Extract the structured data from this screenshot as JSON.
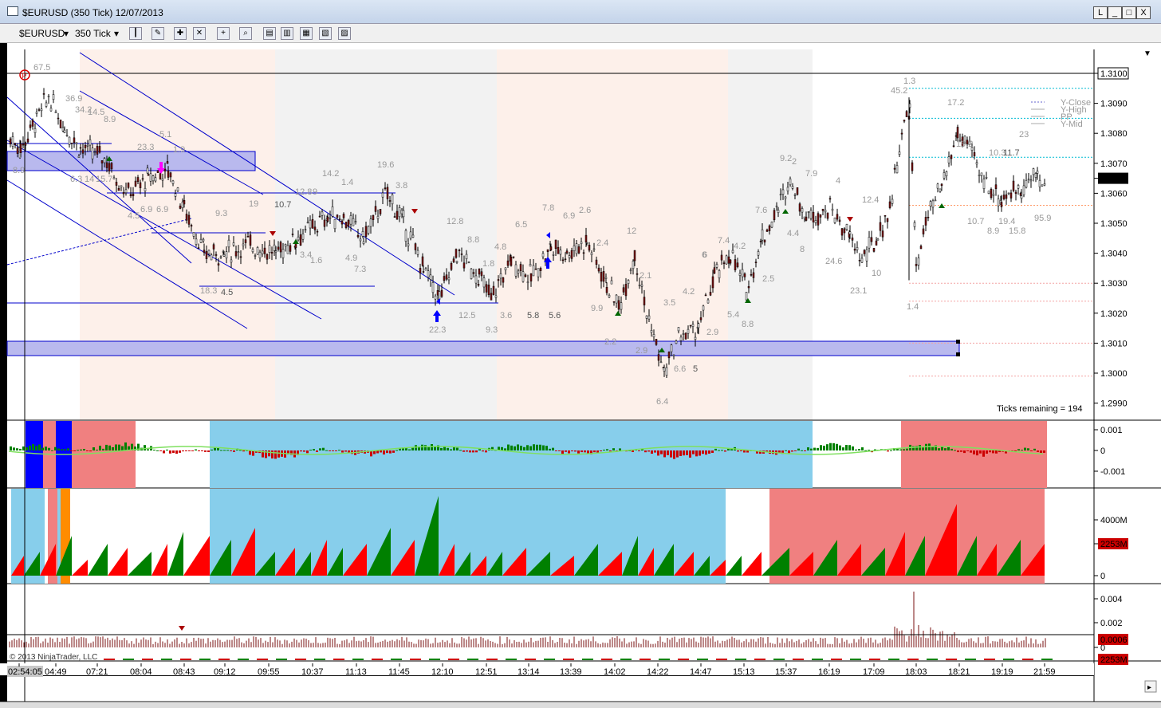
{
  "window": {
    "title": "$EURUSD (350 Tick)  12/07/2013",
    "controls": [
      "L",
      "_",
      "□",
      "X"
    ]
  },
  "toolbar": {
    "instrument": "$EURUSD",
    "interval": "350 Tick",
    "icons": [
      "bar-type-icon",
      "pencil-icon",
      "crosshair-add-icon",
      "crosshair-remove-icon",
      "crosshair-icon",
      "zoom-icon",
      "strategy-icon",
      "indicator-icon",
      "chart-trader-icon",
      "data-box-icon",
      "properties-icon"
    ]
  },
  "price_axis": {
    "ticks": [
      "1.3100",
      "1.3090",
      "1.3080",
      "1.3070",
      "1.3065",
      "1.3060",
      "1.3050",
      "1.3040",
      "1.3030",
      "1.3020",
      "1.3010",
      "1.3000",
      "1.2990"
    ],
    "current_price": "1.3065",
    "marked_level": "1.3100"
  },
  "legend": {
    "items": [
      "Y-Close",
      "Y-High",
      "PP",
      "Y-Mid"
    ]
  },
  "ticks_remaining": "Ticks remaining = 194",
  "panel2_axis": [
    "0.001",
    "0",
    "-0.001"
  ],
  "panel3_axis": [
    "4000M",
    "2253M",
    "0"
  ],
  "panel3_current": "2253M",
  "panel4_axis": [
    "0.004",
    "0.002",
    "0"
  ],
  "panel4_current": "0.0006",
  "panel5_current": "2253M",
  "time_axis": [
    "02:54:05",
    "04:49",
    "07:21",
    "08:04",
    "08:43",
    "09:12",
    "09:55",
    "10:37",
    "11:13",
    "11:45",
    "12:10",
    "12:51",
    "13:14",
    "13:39",
    "14:02",
    "14:22",
    "14:47",
    "15:13",
    "15:37",
    "16:19",
    "17:09",
    "18:03",
    "18:21",
    "19:19",
    "21:59"
  ],
  "copyright": "© 2013 NinjaTrader, LLC",
  "volume_labels": [
    {
      "t": "67.5",
      "c": "l"
    },
    {
      "t": "36.9",
      "c": "l"
    },
    {
      "t": "34.2",
      "c": "l"
    },
    {
      "t": "14.5",
      "c": "l"
    },
    {
      "t": "8.9",
      "c": "l"
    },
    {
      "t": "23.3",
      "c": "l"
    },
    {
      "t": "5.1",
      "c": "l"
    },
    {
      "t": "1.9",
      "c": "l"
    },
    {
      "t": "8.9",
      "c": "l"
    },
    {
      "t": "6.3",
      "c": "l"
    },
    {
      "t": "14",
      "c": "l"
    },
    {
      "t": "15.7",
      "c": "l"
    },
    {
      "t": "4.5",
      "c": "l"
    },
    {
      "t": "6.9",
      "c": "l"
    },
    {
      "t": "6.9",
      "c": "l"
    },
    {
      "t": "9.3",
      "c": "l"
    },
    {
      "t": "19",
      "c": "l"
    },
    {
      "t": "10.7",
      "c": "d"
    },
    {
      "t": "12.8",
      "c": "l"
    },
    {
      "t": "9",
      "c": "l"
    },
    {
      "t": "14.2",
      "c": "l"
    },
    {
      "t": "1.4",
      "c": "l"
    },
    {
      "t": "19.6",
      "c": "l"
    },
    {
      "t": "3.8",
      "c": "l"
    },
    {
      "t": "3.4",
      "c": "l"
    },
    {
      "t": "1.6",
      "c": "l"
    },
    {
      "t": "4.9",
      "c": "l"
    },
    {
      "t": "7.3",
      "c": "l"
    },
    {
      "t": "18.3",
      "c": "l"
    },
    {
      "t": "4.5",
      "c": "d"
    },
    {
      "t": "12.8",
      "c": "l"
    },
    {
      "t": "8.8",
      "c": "l"
    },
    {
      "t": "4.8",
      "c": "l"
    },
    {
      "t": "1.8",
      "c": "l"
    },
    {
      "t": "12.5",
      "c": "l"
    },
    {
      "t": "22.3",
      "c": "l"
    },
    {
      "t": "9.3",
      "c": "l"
    },
    {
      "t": "3.6",
      "c": "l"
    },
    {
      "t": "5.8",
      "c": "d"
    },
    {
      "t": "5.6",
      "c": "d"
    },
    {
      "t": "6.5",
      "c": "l"
    },
    {
      "t": "7.8",
      "c": "l"
    },
    {
      "t": "6.9",
      "c": "l"
    },
    {
      "t": "2.6",
      "c": "l"
    },
    {
      "t": "2.4",
      "c": "l"
    },
    {
      "t": "12",
      "c": "l"
    },
    {
      "t": "6",
      "c": "l"
    },
    {
      "t": "9.9",
      "c": "l"
    },
    {
      "t": "2.1",
      "c": "l"
    },
    {
      "t": "3.5",
      "c": "l"
    },
    {
      "t": "4.2",
      "c": "l"
    },
    {
      "t": "2.9",
      "c": "l"
    },
    {
      "t": "2.2",
      "c": "l"
    },
    {
      "t": "2.9",
      "c": "l"
    },
    {
      "t": "6.6",
      "c": "l"
    },
    {
      "t": "5",
      "c": "d"
    },
    {
      "t": "6.4",
      "c": "l"
    },
    {
      "t": "6",
      "c": "l"
    },
    {
      "t": "7.4",
      "c": "l"
    },
    {
      "t": "4.2",
      "c": "l"
    },
    {
      "t": "5.4",
      "c": "l"
    },
    {
      "t": "8.8",
      "c": "l"
    },
    {
      "t": "2.5",
      "c": "l"
    },
    {
      "t": "9.2",
      "c": "l"
    },
    {
      "t": "2",
      "c": "l"
    },
    {
      "t": "7.9",
      "c": "l"
    },
    {
      "t": "7.6",
      "c": "l"
    },
    {
      "t": "4.4",
      "c": "l"
    },
    {
      "t": "8",
      "c": "l"
    },
    {
      "t": "4",
      "c": "l"
    },
    {
      "t": "24.6",
      "c": "l"
    },
    {
      "t": "12.4",
      "c": "l"
    },
    {
      "t": "10",
      "c": "l"
    },
    {
      "t": "23.1",
      "c": "l"
    },
    {
      "t": "45.2",
      "c": "l"
    },
    {
      "t": "1.3",
      "c": "l"
    },
    {
      "t": "1.4",
      "c": "l"
    },
    {
      "t": "17.2",
      "c": "l"
    },
    {
      "t": "19.2",
      "c": "l"
    },
    {
      "t": "10.3",
      "c": "l"
    },
    {
      "t": "11.7",
      "c": "d"
    },
    {
      "t": "23",
      "c": "l"
    },
    {
      "t": "10.7",
      "c": "l"
    },
    {
      "t": "8.9",
      "c": "l"
    },
    {
      "t": "19.4",
      "c": "l"
    },
    {
      "t": "15.8",
      "c": "l"
    },
    {
      "t": "95.9",
      "c": "l"
    }
  ],
  "colors": {
    "up_candle": "#f5f5f5",
    "down_candle": "#7a1010",
    "session_peach": "#fdf0ea",
    "session_gray": "#f2f2f2",
    "zone": "#b9b9ee",
    "trendline": "#0000cc",
    "sky": "#87ceeb",
    "salmon": "#f08080",
    "green": "#008000",
    "red": "#ff0000"
  }
}
